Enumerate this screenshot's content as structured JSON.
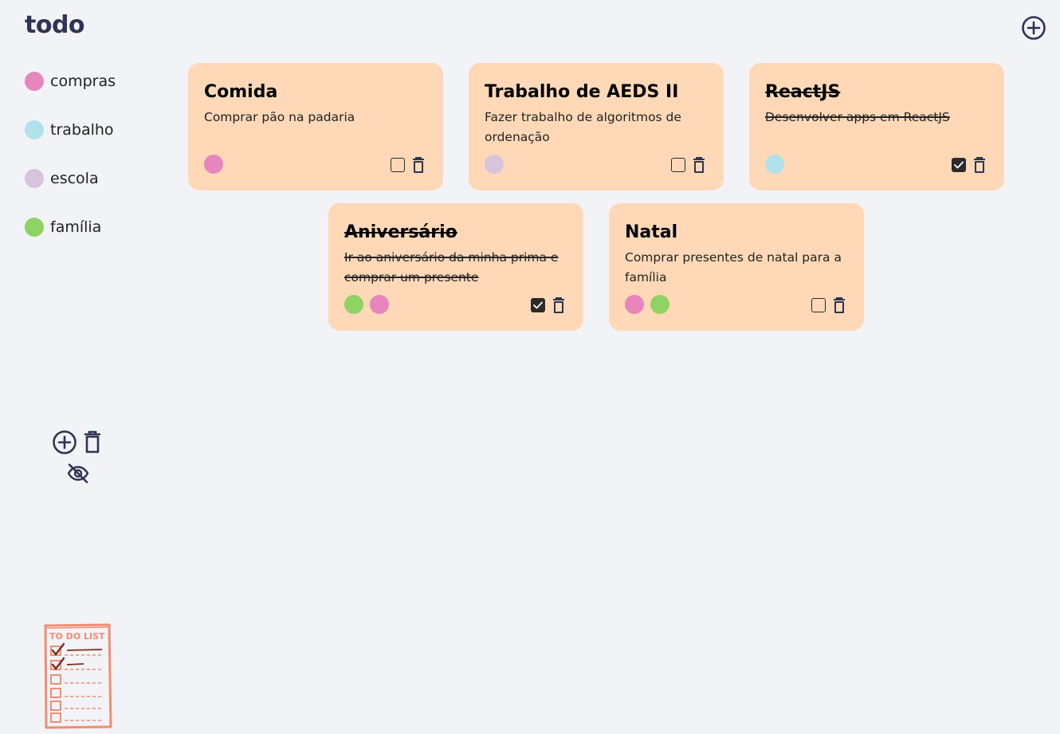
{
  "app": {
    "title": "todo"
  },
  "colors": {
    "bg": "#f2f3f7",
    "card": "#ffd9b7",
    "icon": "#2e3451",
    "logo": "#f08d73"
  },
  "categories": [
    {
      "label": "compras",
      "color": "#e785bd",
      "icon": "dot-pink"
    },
    {
      "label": "trabalho",
      "color": "#b1e1ea",
      "icon": "dot-lightblue"
    },
    {
      "label": "escola",
      "color": "#d8c3dd",
      "icon": "dot-lavender"
    },
    {
      "label": "família",
      "color": "#8fd462",
      "icon": "dot-green"
    }
  ],
  "category_actions": [
    "add-icon",
    "trash-icon",
    "eye-off-icon"
  ],
  "logo": {
    "text": "TO DO LIST"
  },
  "notes": [
    {
      "title": "Comida",
      "description": "Comprar pão na padaria",
      "done": false,
      "tags": [
        "#e785bd"
      ]
    },
    {
      "title": "Trabalho de AEDS II",
      "description": "Fazer trabalho de algoritmos de ordenação",
      "done": false,
      "tags": [
        "#d8c3dd"
      ]
    },
    {
      "title": "ReactJS",
      "description": "Desenvolver apps em ReactJS",
      "done": true,
      "tags": [
        "#b1e1ea"
      ]
    },
    {
      "title": "Aniversário",
      "description": "Ir ao aniversário da minha prima e comprar um presente",
      "done": true,
      "tags": [
        "#8fd462",
        "#e785bd"
      ]
    },
    {
      "title": "Natal",
      "description": "Comprar presentes de natal para a família",
      "done": false,
      "tags": [
        "#e785bd",
        "#8fd462"
      ]
    }
  ]
}
